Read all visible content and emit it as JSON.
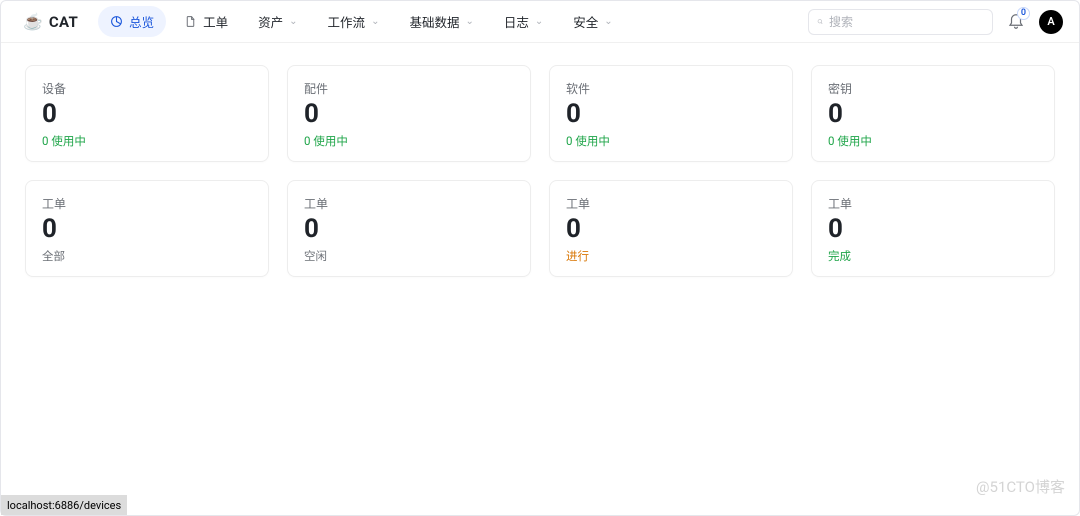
{
  "logo": {
    "emoji": "☕",
    "text": "CAT"
  },
  "nav": {
    "items": [
      {
        "label": "总览",
        "active": true,
        "icon": "pie-icon",
        "has_chevron": false
      },
      {
        "label": "工单",
        "active": false,
        "icon": "file-icon",
        "has_chevron": false
      },
      {
        "label": "资产",
        "active": false,
        "icon": null,
        "has_chevron": true
      },
      {
        "label": "工作流",
        "active": false,
        "icon": null,
        "has_chevron": true
      },
      {
        "label": "基础数据",
        "active": false,
        "icon": null,
        "has_chevron": true
      },
      {
        "label": "日志",
        "active": false,
        "icon": null,
        "has_chevron": true
      },
      {
        "label": "安全",
        "active": false,
        "icon": null,
        "has_chevron": true
      }
    ]
  },
  "search": {
    "placeholder": "搜索"
  },
  "notifications": {
    "count": "0"
  },
  "avatar": {
    "initial": "A"
  },
  "cards": [
    {
      "title": "设备",
      "value": "0",
      "sub": "0 使用中",
      "sub_style": "sub-green"
    },
    {
      "title": "配件",
      "value": "0",
      "sub": "0 使用中",
      "sub_style": "sub-green"
    },
    {
      "title": "软件",
      "value": "0",
      "sub": "0 使用中",
      "sub_style": "sub-green"
    },
    {
      "title": "密钥",
      "value": "0",
      "sub": "0 使用中",
      "sub_style": "sub-green"
    },
    {
      "title": "工单",
      "value": "0",
      "sub": "全部",
      "sub_style": "sub-gray"
    },
    {
      "title": "工单",
      "value": "0",
      "sub": "空闲",
      "sub_style": "sub-gray"
    },
    {
      "title": "工单",
      "value": "0",
      "sub": "进行",
      "sub_style": "sub-orange"
    },
    {
      "title": "工单",
      "value": "0",
      "sub": "完成",
      "sub_style": "sub-green"
    }
  ],
  "status": {
    "url": "localhost:6886/devices"
  },
  "watermark": "@51CTO博客"
}
